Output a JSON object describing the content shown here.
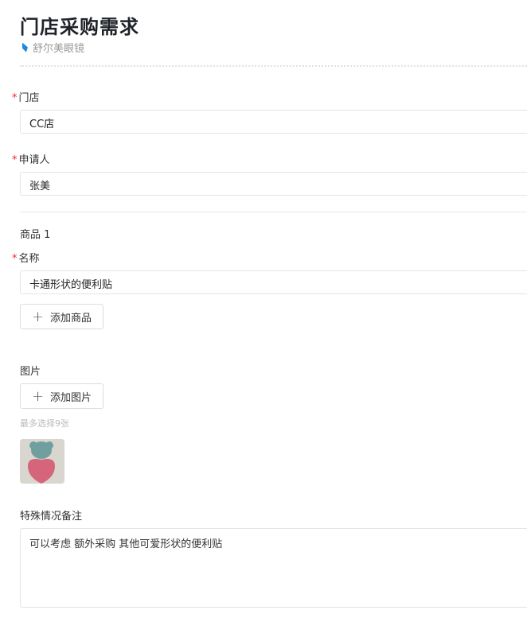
{
  "header": {
    "title": "门店采购需求",
    "subtitle": "舒尔美眼镜"
  },
  "fields": {
    "store": {
      "label": "门店",
      "value": "CC店"
    },
    "applicant": {
      "label": "申请人",
      "value": "张美"
    },
    "product_section": "商品 1",
    "product_name": {
      "label": "名称",
      "value": "卡通形状的便利贴"
    },
    "add_product": "添加商品",
    "image": {
      "label": "图片",
      "add": "添加图片",
      "hint": "最多选择9张"
    },
    "remark": {
      "label": "特殊情况备注",
      "value": "可以考虑 额外采购 其他可爱形状的便利贴"
    }
  },
  "required_mark": "*",
  "colors": {
    "accent": "#1e88e5",
    "required": "#f5222d"
  }
}
